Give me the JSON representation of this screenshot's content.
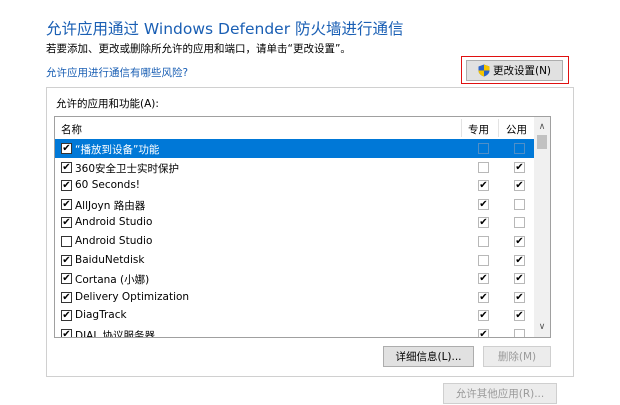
{
  "header": {
    "title": "允许应用通过 Windows Defender 防火墙进行通信",
    "subtitle": "若要添加、更改或删除所允许的应用和端口，请单击“更改设置”。",
    "risk_link": "允许应用进行通信有哪些风险?",
    "change_settings_label": "更改设置(N)"
  },
  "group": {
    "label": "允许的应用和功能(A):",
    "columns": {
      "name": "名称",
      "private": "专用",
      "public": "公用"
    },
    "rows": [
      {
        "name": "“播放到设备”功能",
        "enabled": true,
        "private": false,
        "public": false,
        "selected": true
      },
      {
        "name": "360安全卫士实时保护",
        "enabled": true,
        "private": false,
        "public": true
      },
      {
        "name": "60 Seconds!",
        "enabled": true,
        "private": true,
        "public": true
      },
      {
        "name": "AllJoyn 路由器",
        "enabled": true,
        "private": true,
        "public": false
      },
      {
        "name": "Android Studio",
        "enabled": true,
        "private": true,
        "public": false
      },
      {
        "name": "Android Studio",
        "enabled": false,
        "private": false,
        "public": true
      },
      {
        "name": "BaiduNetdisk",
        "enabled": true,
        "private": false,
        "public": true
      },
      {
        "name": "Cortana (小娜)",
        "enabled": true,
        "private": true,
        "public": true
      },
      {
        "name": "Delivery Optimization",
        "enabled": true,
        "private": true,
        "public": true
      },
      {
        "name": "DiagTrack",
        "enabled": true,
        "private": true,
        "public": true
      },
      {
        "name": "DIAL 协议服务器",
        "enabled": true,
        "private": true,
        "public": false
      }
    ],
    "details_label": "详细信息(L)...",
    "remove_label": "删除(M)"
  },
  "footer": {
    "allow_other_label": "允许其他应用(R)..."
  }
}
